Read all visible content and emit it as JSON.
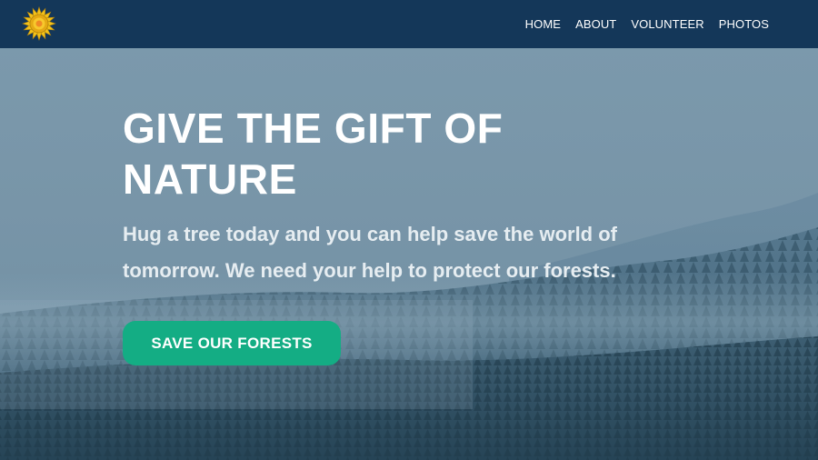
{
  "colors": {
    "navbar_background": "#143759",
    "hero_sky": "#7897ab",
    "cta_background": "#14ad84",
    "text": "#ffffff"
  },
  "header": {
    "logo_icon": "sunflower-logo-icon",
    "nav_items": [
      {
        "label": "HOME"
      },
      {
        "label": "ABOUT"
      },
      {
        "label": "VOLUNTEER"
      },
      {
        "label": "PHOTOS"
      }
    ]
  },
  "hero": {
    "title": "GIVE THE GIFT OF NATURE",
    "subtitle": "Hug a tree today and you can help save the world of tomorrow. We need your help to protect our forests.",
    "cta_label": "SAVE OUR FORESTS",
    "background_image": "misty-forest-image"
  }
}
